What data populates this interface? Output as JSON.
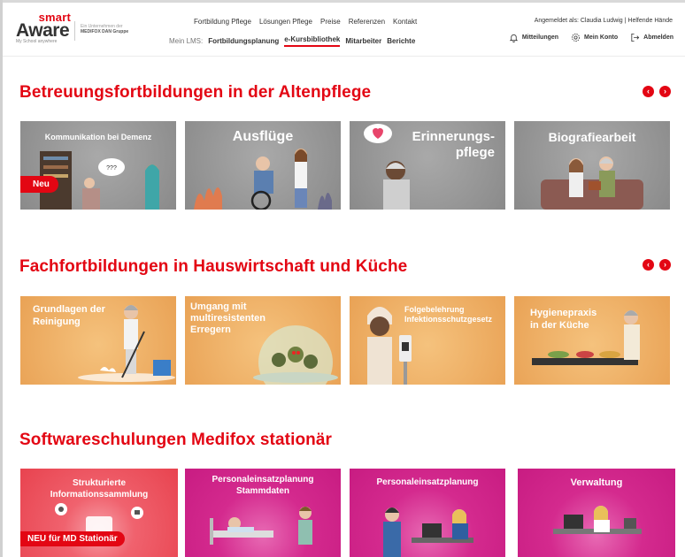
{
  "brand": {
    "smart": "smart",
    "aware": "Aware",
    "tagline": "My School anywhere",
    "group_line1": "Ein Unternehmen der",
    "group_line2": "MEDIFOX DAN Gruppe"
  },
  "nav_top": [
    "Fortbildung Pflege",
    "Lösungen Pflege",
    "Preise",
    "Referenzen",
    "Kontakt"
  ],
  "nav_lms": {
    "label": "Mein LMS:",
    "items": [
      "Fortbildungsplanung",
      "e-Kursbibliothek",
      "Mitarbeiter",
      "Berichte"
    ],
    "active": "e-Kursbibliothek"
  },
  "login": {
    "text": "Angemeldet als: Claudia Ludwig | Helfende Hände"
  },
  "actions": {
    "notifications": "Mitteilungen",
    "account": "Mein Konto",
    "logout": "Abmelden"
  },
  "colors": {
    "accent": "#e30613",
    "grey": "#999999",
    "orange": "#eeac62",
    "pink": "#d42a8e"
  },
  "sections": [
    {
      "title": "Betreuungsfortbildungen in der Altenpflege",
      "cards": [
        {
          "title": "Kommunikation bei Demenz",
          "badge": "Neu",
          "bubble": "???"
        },
        {
          "title": "Ausflüge"
        },
        {
          "title": "Erinnerungs-\npflege"
        },
        {
          "title": "Biografiearbeit"
        }
      ]
    },
    {
      "title": "Fachfortbildungen in Hauswirtschaft und Küche",
      "cards": [
        {
          "title": "Grundlagen der\nReinigung"
        },
        {
          "title": "Umgang mit\nmultiresistenten\nErregern"
        },
        {
          "title": "Folgebelehrung\nInfektionsschutzgesetz"
        },
        {
          "title": "Hygienepraxis\nin der Küche"
        }
      ]
    },
    {
      "title": "Softwareschulungen Medifox stationär",
      "cards": [
        {
          "title": "Strukturierte\nInformationssammlung",
          "badge": "NEU für MD Stationär"
        },
        {
          "title": "Personaleinsatzplanung\nStammdaten"
        },
        {
          "title": "Personaleinsatzplanung"
        },
        {
          "title": "Verwaltung"
        }
      ]
    }
  ],
  "carousel": {
    "prev": "‹",
    "next": "›"
  }
}
